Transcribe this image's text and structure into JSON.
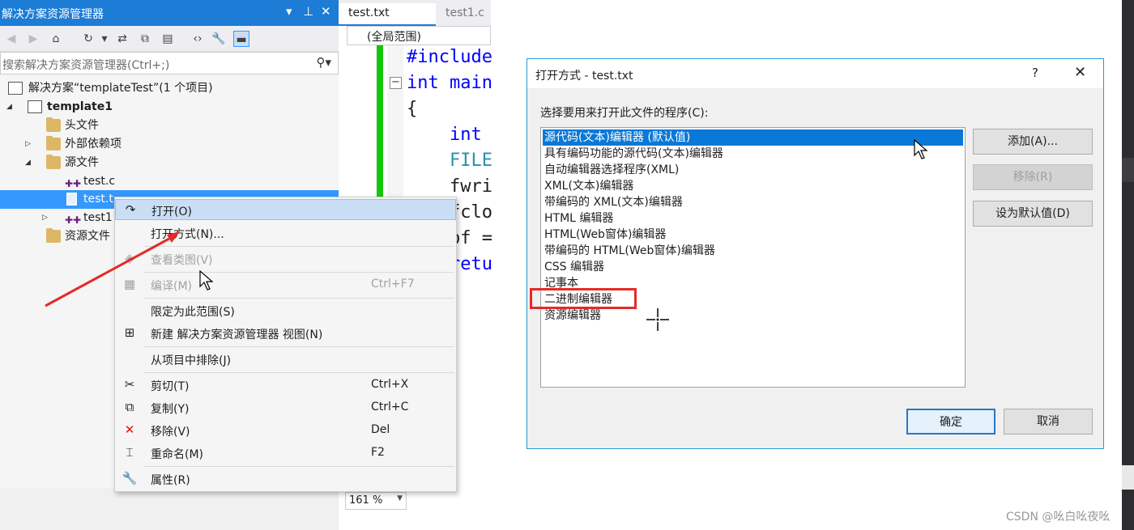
{
  "solution_explorer": {
    "title": "解决方案资源管理器",
    "title_controls": [
      "▾",
      "⊥",
      "✕"
    ],
    "search_placeholder": "搜索解决方案资源管理器(Ctrl+;)",
    "tree": [
      {
        "label": "解决方案“templateTest”(1 个项目)"
      },
      {
        "label": "template1"
      },
      {
        "label": "头文件"
      },
      {
        "label": "外部依赖项"
      },
      {
        "label": "源文件"
      },
      {
        "label": "test.c"
      },
      {
        "label": "test.t"
      },
      {
        "label": "test1"
      },
      {
        "label": "资源文件"
      }
    ]
  },
  "editor": {
    "tabs": [
      "test.txt",
      "test1.c"
    ],
    "scope": "(全局范围)",
    "code_lines": [
      "#include",
      "int main",
      "{",
      "int",
      "FILE",
      "fwri",
      "fclo",
      "pf =",
      "retu"
    ],
    "zoom": "161 %"
  },
  "context_menu": {
    "items": [
      {
        "icon": "↷",
        "label": "打开(O)",
        "shortcut": ""
      },
      {
        "icon": "",
        "label": "打开方式(N)...",
        "shortcut": ""
      },
      {
        "icon": "◈",
        "label": "查看类图(V)",
        "shortcut": ""
      },
      {
        "icon": "▦",
        "label": "编译(M)",
        "shortcut": "Ctrl+F7"
      },
      {
        "icon": "",
        "label": "限定为此范围(S)",
        "shortcut": ""
      },
      {
        "icon": "⊞",
        "label": "新建 解决方案资源管理器 视图(N)",
        "shortcut": ""
      },
      {
        "icon": "",
        "label": "从项目中排除(J)",
        "shortcut": ""
      },
      {
        "icon": "✂",
        "label": "剪切(T)",
        "shortcut": "Ctrl+X"
      },
      {
        "icon": "⧉",
        "label": "复制(Y)",
        "shortcut": "Ctrl+C"
      },
      {
        "icon": "✕",
        "label": "移除(V)",
        "shortcut": "Del"
      },
      {
        "icon": "⌶",
        "label": "重命名(M)",
        "shortcut": "F2"
      },
      {
        "icon": "🔧",
        "label": "属性(R)",
        "shortcut": ""
      }
    ]
  },
  "dialog": {
    "title": "打开方式 - test.txt",
    "help": "?",
    "close": "✕",
    "prompt": "选择要用来打开此文件的程序(C):",
    "programs": [
      "源代码(文本)编辑器 (默认值)",
      "具有编码功能的源代码(文本)编辑器",
      "自动编辑器选择程序(XML)",
      "XML(文本)编辑器",
      "带编码的 XML(文本)编辑器",
      "HTML 编辑器",
      "HTML(Web窗体)编辑器",
      "带编码的 HTML(Web窗体)编辑器",
      "CSS 编辑器",
      "记事本",
      "二进制编辑器",
      "资源编辑器"
    ],
    "buttons": {
      "add": "添加(A)...",
      "remove": "移除(R)",
      "set_default": "设为默认值(D)",
      "ok": "确定",
      "cancel": "取消"
    }
  },
  "watermark": "CSDN @吆白吆夜吆",
  "colors": {
    "accent": "#1c7cd6",
    "selection": "#3399ff",
    "highlight_box": "#e52a2a"
  }
}
